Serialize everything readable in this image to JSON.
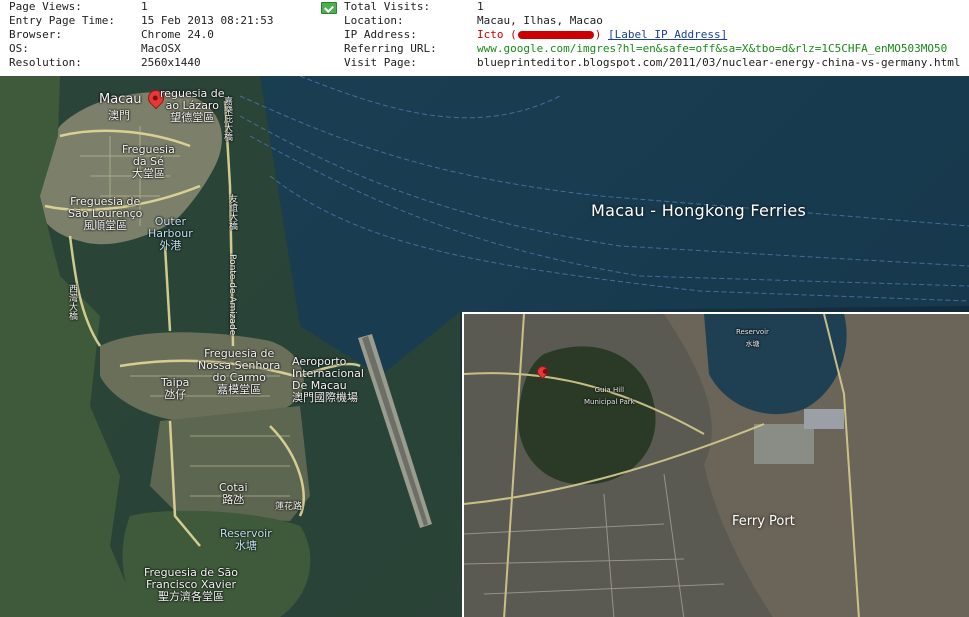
{
  "visit_info": {
    "rows": [
      {
        "label": "Page Views:",
        "value": "1",
        "label2": "Total Visits:",
        "value2": "1"
      },
      {
        "label": "Entry Page Time:",
        "value": "15 Feb 2013 08:21:53",
        "label2": "Location:",
        "value2": "Macau, Ilhas, Macao"
      },
      {
        "label": "Browser:",
        "value": "Chrome 24.0",
        "label2": "IP Address:",
        "value2": ""
      },
      {
        "label": "OS:",
        "value": "MacOSX",
        "label2": "Referring URL:",
        "value2": "www.google.com/imgres?hl=en&safe=off&sa=X&tbo=d&rlz=1C5CHFA_enMO503MO50"
      },
      {
        "label": "Resolution:",
        "value": "2560x1440",
        "label2": "Visit Page:",
        "value2": "blueprinteditor.blogspot.com/2011/03/nuclear-energy-china-vs-germany.html"
      }
    ],
    "ip": {
      "isp": "Icto (",
      "close": ")",
      "label_link": "[Label IP Address]"
    },
    "icons": {
      "status": "monitor-check-icon"
    },
    "colors": {
      "red": "#cc0000",
      "green": "#1a8a1a",
      "link": "#1a3f9a"
    }
  },
  "map": {
    "labels": {
      "macau": "Macau",
      "macau_cn": "澳門",
      "lazaro": "reguesia de\nao Lázaro\n望德堂區",
      "se": "Freguesia\nda Sé\n大堂區",
      "lourenco": "Freguesia de\nSão Lourenço\n風順堂區",
      "outer_harbour": "Outer\nHarbour\n外港",
      "carmo": "Freguesia de\nNossa Senhora\ndo Carmo\n嘉模堂區",
      "taipa": "Taipa\n氹仔",
      "airport": "Aeroporto\nInternacional\nDe Macau\n澳門國際機場",
      "cotai": "Cotai\n路氹",
      "reservoir": "Reservoir\n水塘",
      "xavier": "Freguesia de São\nFrancisco Xavier\n聖方濟各堂區",
      "ponte_amizade": "Ponte de Amizade",
      "lotus_cn": "蓮花路",
      "bridge1_cn": "友誼大橋",
      "bridge2_cn": "西灣大橋",
      "bridge3_cn": "嘉樂庇大橋"
    },
    "annotation": "Macau - Hongkong Ferries",
    "inset": {
      "annotation": "Ferry Port",
      "reservoir": "Reservoir\n水塘",
      "park": "Guia Hill\nMunicipal Park"
    },
    "icons": {
      "pin": "location-pin-icon"
    }
  }
}
